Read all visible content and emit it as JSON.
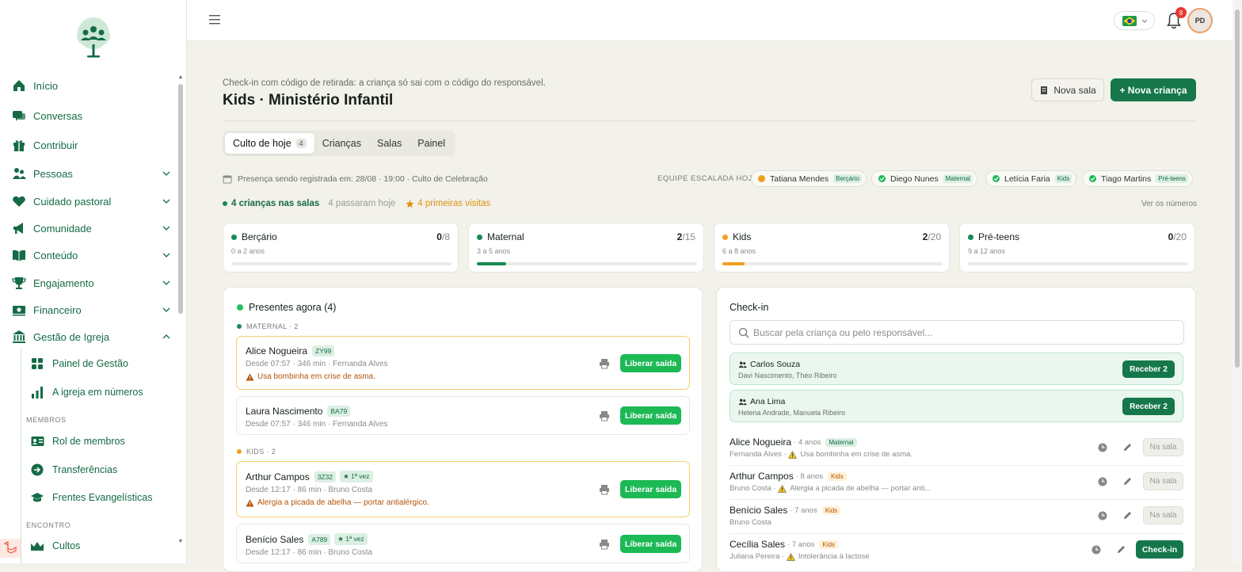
{
  "colors": {
    "brand": "#146b45",
    "primary": "#15774a",
    "release": "#1cb955",
    "warning": "#e09112",
    "alert": "#b45309",
    "danger": "#e53935"
  },
  "sidebar": {
    "items": [
      {
        "label": "Início",
        "icon": "home-icon"
      },
      {
        "label": "Conversas",
        "icon": "chat-icon"
      },
      {
        "label": "Contribuir",
        "icon": "gift-icon"
      },
      {
        "label": "Pessoas",
        "icon": "users-icon"
      },
      {
        "label": "Cuidado pastoral",
        "icon": "heart-icon"
      },
      {
        "label": "Comunidade",
        "icon": "megaphone-icon"
      },
      {
        "label": "Conteúdo",
        "icon": "book-icon"
      },
      {
        "label": "Engajamento",
        "icon": "trophy-icon"
      },
      {
        "label": "Financeiro",
        "icon": "money-icon"
      },
      {
        "label": "Gestão de Igreja",
        "icon": "bank-icon"
      }
    ],
    "subitems": [
      {
        "label": "Painel de Gestão",
        "icon": "dashboard-icon"
      },
      {
        "label": "A igreja em números",
        "icon": "bar-chart-icon"
      }
    ],
    "section_membros": "MEMBROS",
    "membros_items": [
      {
        "label": "Rol de membros",
        "icon": "id-card-icon"
      },
      {
        "label": "Transferências",
        "icon": "arrow-circle-icon"
      },
      {
        "label": "Frentes Evangelísticas",
        "icon": "graduation-cap-icon"
      }
    ],
    "section_encontro": "ENCONTRO",
    "encontro_items": [
      {
        "label": "Cultos",
        "icon": "crown-icon"
      }
    ]
  },
  "topbar": {
    "notifications_count": "8",
    "avatar_initials": "PD",
    "language_flag": "brazil-flag-icon"
  },
  "header": {
    "subtitle": "Check-in com código de retirada: a criança só sai com o código do responsável.",
    "title": "Kids · Ministério Infantil",
    "new_room": "Nova sala",
    "new_child": "+ Nova criança"
  },
  "tabs": [
    {
      "label": "Culto de hoje",
      "count": "4"
    },
    {
      "label": "Crianças"
    },
    {
      "label": "Salas"
    },
    {
      "label": "Painel"
    }
  ],
  "presence": "Presença sendo registrada em: 28/08 · 19:00 · Culto de Celebração",
  "team": {
    "label": "EQUIPE ESCALADA HOJE",
    "members": [
      {
        "name": "Tatiana Mendes",
        "room": "Berçário",
        "status": "pending"
      },
      {
        "name": "Diego Nunes",
        "room": "Maternal",
        "status": "ok"
      },
      {
        "name": "Letícia Faria",
        "room": "Kids",
        "status": "ok"
      },
      {
        "name": "Tiago Martins",
        "room": "Pré-teens",
        "status": "ok"
      }
    ]
  },
  "stats": {
    "in_rooms": "4 crianças nas salas",
    "passed": "4 passaram hoje",
    "first_visits": "4 primeiras visitas",
    "see_numbers": "Ver os números"
  },
  "rooms": [
    {
      "name": "Berçário",
      "age": "0 a 2 anos",
      "count": "0",
      "capacity": "/8",
      "fill": 0,
      "color": "#178a54"
    },
    {
      "name": "Maternal",
      "age": "3 a 5 anos",
      "count": "2",
      "capacity": "/15",
      "fill": 0.133,
      "color": "#178a54"
    },
    {
      "name": "Kids",
      "age": "6 a 8 anos",
      "count": "2",
      "capacity": "/20",
      "fill": 0.1,
      "color": "#f0a020"
    },
    {
      "name": "Pré-teens",
      "age": "9 a 12 anos",
      "count": "0",
      "capacity": "/20",
      "fill": 0,
      "color": "#178a54"
    }
  ],
  "present": {
    "title": "Presentes agora (4)",
    "group_maternal": "MATERNAL · 2",
    "group_kids": "KIDS · 2",
    "release_label": "Liberar saída",
    "first_label": "1ª vez",
    "children": [
      {
        "name": "Alice Nogueira",
        "code": "ZY99",
        "since": "Desde 07:57 · 346 min · Fernanda Alves",
        "alert": "Usa bombinha em crise de asma."
      },
      {
        "name": "Laura Nascimento",
        "code": "BA79",
        "since": "Desde 07:57 · 346 min · Fernanda Alves"
      },
      {
        "name": "Arthur Campos",
        "code": "3Z32",
        "since": "Desde 12:17 · 86 min · Bruno Costa",
        "alert": "Alergia a picada de abelha — portar antialérgico."
      },
      {
        "name": "Benício Sales",
        "code": "A789",
        "since": "Desde 12:17 · 86 min · Bruno Costa"
      }
    ]
  },
  "checkin": {
    "title": "Check-in",
    "search_placeholder": "Buscar pela criança ou pelo responsável...",
    "guardians": [
      {
        "name": "Carlos Souza",
        "kids": "Davi Nascimento, Théo Ribeiro",
        "action": "Receber 2"
      },
      {
        "name": "Ana Lima",
        "kids": "Helena Andrade, Manuela Ribeiro",
        "action": "Receber 2"
      }
    ],
    "rows": [
      {
        "name": "Alice Nogueira",
        "age": "· 4 anos",
        "room": "Maternal",
        "sub": "Fernanda Alves ·",
        "alert": "Usa bombinha em crise de asma.",
        "action": "Na sala"
      },
      {
        "name": "Arthur Campos",
        "age": "· 8 anos",
        "room": "Kids",
        "sub": "Bruno Costa ·",
        "alert": "Alergia a picada de abelha — portar anti...",
        "action": "Na sala"
      },
      {
        "name": "Benício Sales",
        "age": "· 7 anos",
        "room": "Kids",
        "sub": "Bruno Costa",
        "action": "Na sala"
      },
      {
        "name": "Cecília Sales",
        "age": "· 7 anos",
        "room": "Kids",
        "sub": "Juliana Pereira ·",
        "alert": "Intolerância à lactose",
        "action": "Check-in"
      }
    ]
  }
}
